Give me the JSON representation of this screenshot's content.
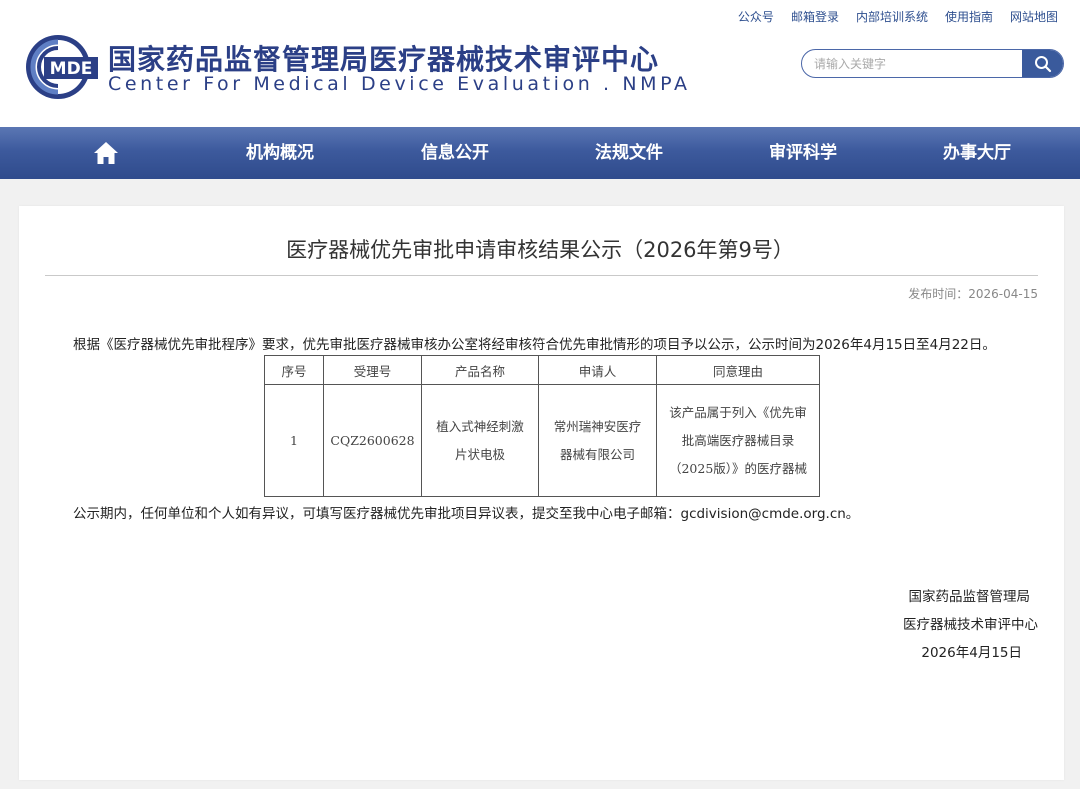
{
  "top_links": [
    "公众号",
    "邮箱登录",
    "内部培训系统",
    "使用指南",
    "网站地图"
  ],
  "logo": {
    "mark_text": "MDE",
    "name_cn": "国家药品监督管理局医疗器械技术审评中心",
    "name_en": "Center For Medical Device Evaluation . NMPA"
  },
  "search": {
    "placeholder": "请输入关键字"
  },
  "nav": {
    "home_icon": "home-icon",
    "items": [
      "机构概况",
      "信息公开",
      "法规文件",
      "审评科学",
      "办事大厅"
    ]
  },
  "article": {
    "title": "医疗器械优先审批申请审核结果公示（2026年第9号）",
    "publish_date": "发布时间：2026-04-15",
    "intro": "根据《医疗器械优先审批程序》要求，优先审批医疗器械审核办公室将经审核符合优先审批情形的项目予以公示，公示时间为2026年4月15日至4月22日。",
    "table": {
      "headers": [
        "序号",
        "受理号",
        "产品名称",
        "申请人",
        "同意理由"
      ],
      "rows": [
        {
          "no": "1",
          "accept_no": "CQZ2600628",
          "product": "植入式神经刺激片状电极",
          "applicant": "常州瑞神安医疗器械有限公司",
          "reason": "该产品属于列入《优先审批高端医疗器械目录（2025版）》的医疗器械"
        }
      ]
    },
    "notice": "公示期内，任何单位和个人如有异议，可填写医疗器械优先审批项目异议表，提交至我中心电子邮箱：gcdivision@cmde.org.cn。",
    "signature": {
      "line1": "国家药品监督管理局",
      "line2": "医疗器械技术审评中心",
      "date": "2026年4月15日"
    }
  },
  "colors": {
    "brand": "#2b3f86",
    "nav": "#3d5a9d"
  }
}
